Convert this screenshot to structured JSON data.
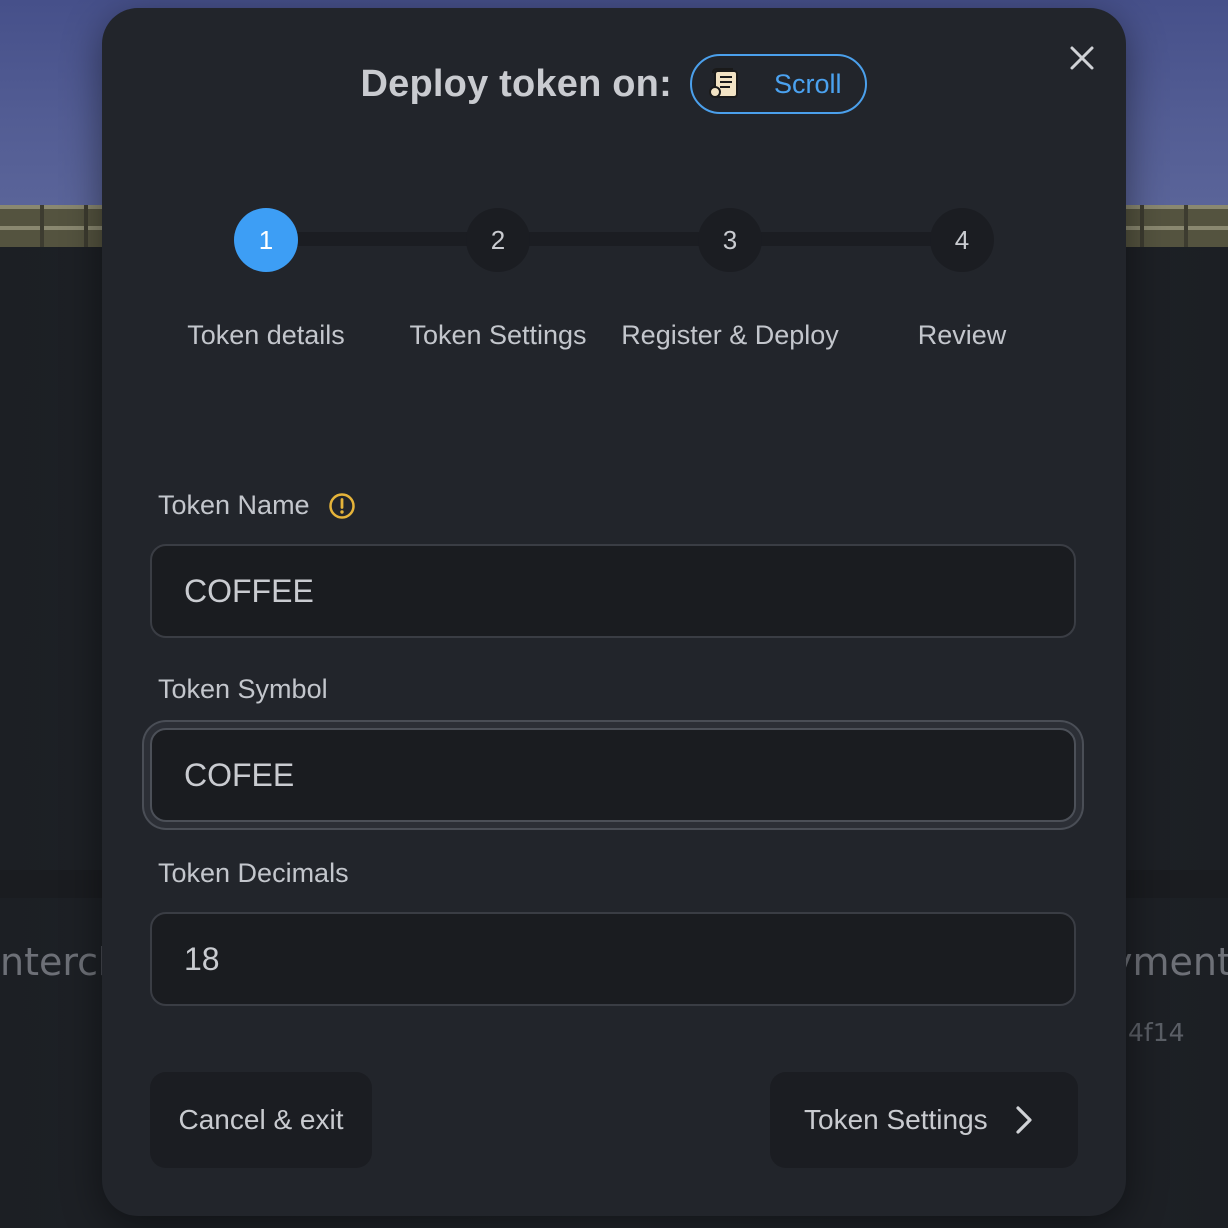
{
  "background": {
    "left_text": "nterch",
    "right_text": "yments",
    "hash_text": "4f14"
  },
  "modal": {
    "title": "Deploy token on:",
    "chain": {
      "name": "Scroll",
      "icon": "scroll-icon"
    },
    "close_icon": "close-icon"
  },
  "stepper": {
    "active_step": 1,
    "steps": [
      {
        "number": "1",
        "label": "Token details"
      },
      {
        "number": "2",
        "label": "Token Settings"
      },
      {
        "number": "3",
        "label": "Register & Deploy"
      },
      {
        "number": "4",
        "label": "Review"
      }
    ]
  },
  "form": {
    "token_name": {
      "label": "Token Name",
      "value": "COFFEE",
      "warning_icon": "warning-icon"
    },
    "token_symbol": {
      "label": "Token Symbol",
      "value": "COFEE"
    },
    "token_decimals": {
      "label": "Token Decimals",
      "value": "18"
    }
  },
  "footer": {
    "cancel_label": "Cancel & exit",
    "next_label": "Token Settings",
    "next_icon": "chevron-right-icon"
  },
  "colors": {
    "accent": "#3d9ef5",
    "chain_border": "#4ba0ec",
    "warning": "#e6b43a",
    "modal_bg": "#22252b"
  }
}
